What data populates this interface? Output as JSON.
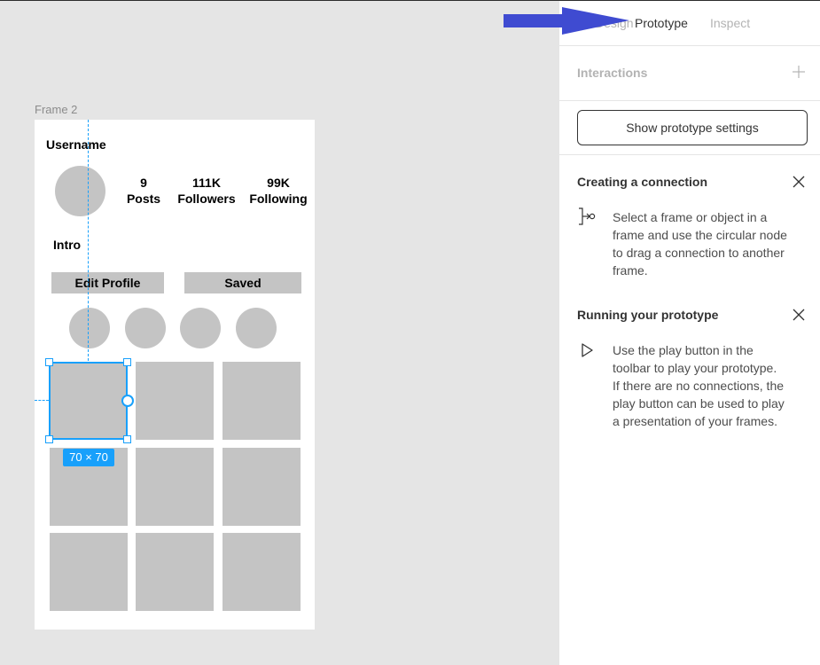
{
  "canvas": {
    "frame_label": "Frame 2",
    "profile": {
      "username": "Username",
      "stats": [
        {
          "value": "9",
          "label": "Posts"
        },
        {
          "value": "111K",
          "label": "Followers"
        },
        {
          "value": "99K",
          "label": "Following"
        }
      ],
      "intro": "Intro",
      "edit_button": "Edit Profile",
      "saved_button": "Saved"
    },
    "selection": {
      "size_label": "70 × 70"
    }
  },
  "panel": {
    "tabs": [
      "Design",
      "Prototype",
      "Inspect"
    ],
    "active_tab": "Prototype",
    "interactions_title": "Interactions",
    "settings_button": "Show prototype settings",
    "sections": [
      {
        "title": "Creating a connection",
        "icon": "connection-icon",
        "lines": [
          "Select a frame or object in a",
          "frame and use the circular node",
          "to drag a connection to another",
          "frame."
        ]
      },
      {
        "title": "Running your prototype",
        "icon": "play-icon",
        "lines": [
          "Use the play button in the",
          "toolbar to play your prototype.",
          "If there are no connections, the",
          "play button can be used to play",
          "a presentation of your frames."
        ]
      }
    ]
  },
  "colors": {
    "selection": "#18a0fb",
    "placeholder": "#c4c4c4",
    "arrow": "#3f4bd1"
  }
}
